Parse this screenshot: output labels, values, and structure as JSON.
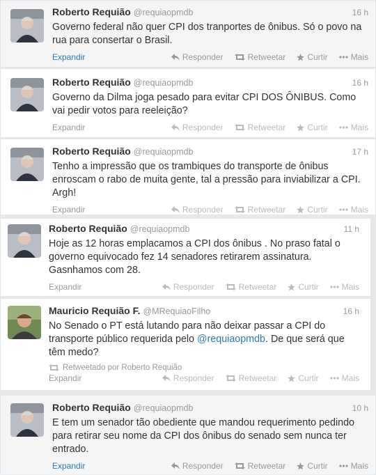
{
  "labels": {
    "expand": "Expandir",
    "reply": "Responder",
    "retweet": "Retweetar",
    "favorite": "Curtir",
    "more": "Mais"
  },
  "tweets": [
    {
      "name": "Roberto Requião",
      "handle": "@requiaopmdb",
      "time": "16 h",
      "text": "Governo federal não quer CPI dos tranportes de ônibus. Só o povo na rua para consertar o Brasil."
    },
    {
      "name": "Roberto Requião",
      "handle": "@requiaopmdb",
      "time": "16 h",
      "text": "Governo da Dilma joga pesado para evitar CPI DOS ÔNIBUS. Como vai pedir votos para reeleição?"
    },
    {
      "name": "Roberto Requião",
      "handle": "@requiaopmdb",
      "time": "17 h",
      "text": "Tenho a impressão que os trambiques do transporte de ônibus enroscam o rabo de muita gente, tal a pressão para inviabilizar a CPI. Argh!"
    },
    {
      "name": "Roberto Requião",
      "handle": "@requiaopmdb",
      "time": "11 h",
      "text": "Hoje as 12 horas emplacamos a CPI dos ônibus . No praso fatal o governo equivocado fez 14 senadores retirarem assinatura. Gasnhamos com 28."
    },
    {
      "name": "Mauricio Requião F.",
      "handle": "@MRequiaoFilho",
      "time": "16 h",
      "text_before": "No Senado o PT está lutando para não deixar passar a CPI do transporte público requerida pelo ",
      "mention": "@requiaopmdb",
      "text_after": ". De que será que têm medo?",
      "retweeted_by": "Retweetado por Roberto Requião"
    },
    {
      "name": "Roberto Requião",
      "handle": "@requiaopmdb",
      "time": "10 h",
      "text": "E tem um senador tão obediente que mandou requerimento pedindo para retirar seu nome da CPI dos ônibus do senado  sem nunca ter entrado."
    }
  ]
}
